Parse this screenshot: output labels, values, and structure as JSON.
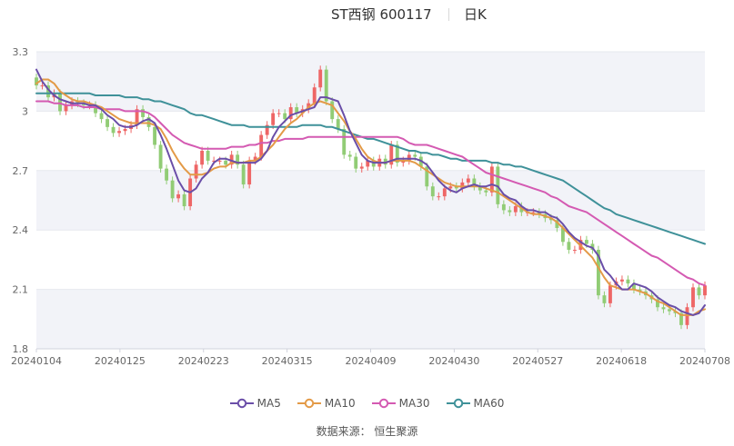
{
  "header": {
    "title": "ST西钢 600117",
    "period": "日K"
  },
  "source": "数据来源： 恒生聚源",
  "colors": {
    "up": "#ee6666",
    "down": "#91cc75",
    "ma5": "#6a4ea8",
    "ma10": "#e39a47",
    "ma30": "#d45ab2",
    "ma60": "#3f9199",
    "band": "#f2f3f8",
    "grid": "#e6e8ee"
  },
  "chart_data": {
    "type": "candlestick",
    "title": "ST西钢 600117 日K",
    "ylim": [
      1.8,
      3.3
    ],
    "yticks": [
      "1.8",
      "2.1",
      "2.4",
      "2.7",
      "3",
      "3.3"
    ],
    "xticks": [
      "20240104",
      "20240125",
      "20240223",
      "20240315",
      "20240409",
      "20240430",
      "20240527",
      "20240618",
      "20240708"
    ],
    "legend": [
      "MA5",
      "MA10",
      "MA30",
      "MA60"
    ],
    "close": [
      3.13,
      3.13,
      3.07,
      3.09,
      3.0,
      3.03,
      3.05,
      3.04,
      3.03,
      3.03,
      2.99,
      2.96,
      2.92,
      2.89,
      2.9,
      2.91,
      2.93,
      3.01,
      2.97,
      2.92,
      2.83,
      2.71,
      2.65,
      2.56,
      2.58,
      2.52,
      2.66,
      2.73,
      2.8,
      2.75,
      2.75,
      2.75,
      2.73,
      2.78,
      2.73,
      2.63,
      2.75,
      2.77,
      2.88,
      2.93,
      2.99,
      2.99,
      2.96,
      3.02,
      2.99,
      3.01,
      3.04,
      3.12,
      3.21,
      3.05,
      2.96,
      2.91,
      2.78,
      2.77,
      2.71,
      2.72,
      2.75,
      2.72,
      2.76,
      2.73,
      2.83,
      2.74,
      2.75,
      2.78,
      2.77,
      2.72,
      2.62,
      2.57,
      2.57,
      2.61,
      2.62,
      2.61,
      2.64,
      2.66,
      2.62,
      2.6,
      2.59,
      2.72,
      2.53,
      2.5,
      2.49,
      2.52,
      2.49,
      2.49,
      2.49,
      2.48,
      2.46,
      2.45,
      2.41,
      2.34,
      2.3,
      2.3,
      2.35,
      2.33,
      2.3,
      2.07,
      2.03,
      2.12,
      2.14,
      2.15,
      2.13,
      2.1,
      2.09,
      2.07,
      2.05,
      2.01,
      2.0,
      1.99,
      1.98,
      1.92,
      2.01,
      2.11,
      2.07,
      2.12
    ],
    "ma5": [
      3.21,
      3.15,
      3.11,
      3.08,
      3.06,
      3.05,
      3.04,
      3.04,
      3.04,
      3.03,
      3.03,
      3.01,
      2.98,
      2.96,
      2.93,
      2.92,
      2.92,
      2.93,
      2.95,
      2.96,
      2.94,
      2.88,
      2.81,
      2.73,
      2.65,
      2.6,
      2.59,
      2.61,
      2.66,
      2.69,
      2.74,
      2.76,
      2.76,
      2.75,
      2.74,
      2.74,
      2.74,
      2.74,
      2.76,
      2.8,
      2.87,
      2.92,
      2.95,
      2.98,
      2.99,
      3.0,
      3.01,
      3.02,
      3.07,
      3.07,
      3.06,
      3.05,
      2.98,
      2.9,
      2.84,
      2.78,
      2.75,
      2.74,
      2.74,
      2.74,
      2.75,
      2.76,
      2.76,
      2.76,
      2.76,
      2.75,
      2.73,
      2.69,
      2.65,
      2.62,
      2.6,
      2.59,
      2.61,
      2.62,
      2.63,
      2.62,
      2.62,
      2.63,
      2.62,
      2.58,
      2.56,
      2.55,
      2.52,
      2.5,
      2.5,
      2.49,
      2.49,
      2.47,
      2.46,
      2.43,
      2.39,
      2.36,
      2.34,
      2.32,
      2.31,
      2.27,
      2.2,
      2.17,
      2.13,
      2.1,
      2.1,
      2.13,
      2.12,
      2.11,
      2.09,
      2.06,
      2.04,
      2.02,
      2.01,
      1.99,
      1.98,
      1.97,
      1.98,
      2.02
    ],
    "ma10": [
      3.14,
      3.16,
      3.16,
      3.14,
      3.1,
      3.08,
      3.06,
      3.05,
      3.05,
      3.04,
      3.03,
      3.02,
      3.0,
      2.98,
      2.96,
      2.95,
      2.94,
      2.94,
      2.94,
      2.94,
      2.93,
      2.91,
      2.86,
      2.8,
      2.75,
      2.71,
      2.68,
      2.68,
      2.68,
      2.69,
      2.71,
      2.72,
      2.72,
      2.74,
      2.74,
      2.74,
      2.75,
      2.75,
      2.77,
      2.8,
      2.83,
      2.87,
      2.91,
      2.94,
      2.96,
      2.99,
      3.02,
      3.04,
      3.05,
      3.04,
      3.03,
      2.99,
      2.95,
      2.9,
      2.86,
      2.81,
      2.77,
      2.75,
      2.74,
      2.74,
      2.75,
      2.75,
      2.75,
      2.75,
      2.74,
      2.72,
      2.7,
      2.68,
      2.66,
      2.64,
      2.63,
      2.62,
      2.62,
      2.62,
      2.62,
      2.62,
      2.61,
      2.6,
      2.59,
      2.57,
      2.55,
      2.53,
      2.51,
      2.49,
      2.48,
      2.48,
      2.47,
      2.46,
      2.44,
      2.41,
      2.38,
      2.35,
      2.32,
      2.29,
      2.26,
      2.21,
      2.16,
      2.12,
      2.11,
      2.1,
      2.1,
      2.1,
      2.09,
      2.08,
      2.06,
      2.04,
      2.03,
      2.01,
      1.99,
      1.97,
      1.97,
      1.97,
      1.99,
      2.0
    ],
    "ma30": [
      3.05,
      3.05,
      3.05,
      3.04,
      3.04,
      3.03,
      3.03,
      3.03,
      3.02,
      3.02,
      3.02,
      3.01,
      3.01,
      3.01,
      3.01,
      3.0,
      3.0,
      3.0,
      3.0,
      2.99,
      2.97,
      2.94,
      2.91,
      2.88,
      2.86,
      2.84,
      2.83,
      2.82,
      2.81,
      2.81,
      2.81,
      2.81,
      2.81,
      2.82,
      2.82,
      2.82,
      2.83,
      2.83,
      2.84,
      2.84,
      2.85,
      2.85,
      2.86,
      2.86,
      2.86,
      2.86,
      2.87,
      2.87,
      2.87,
      2.87,
      2.87,
      2.87,
      2.87,
      2.87,
      2.87,
      2.87,
      2.87,
      2.87,
      2.87,
      2.87,
      2.87,
      2.87,
      2.86,
      2.84,
      2.83,
      2.83,
      2.83,
      2.82,
      2.81,
      2.8,
      2.79,
      2.78,
      2.77,
      2.75,
      2.73,
      2.71,
      2.69,
      2.68,
      2.67,
      2.66,
      2.65,
      2.64,
      2.63,
      2.62,
      2.61,
      2.6,
      2.59,
      2.57,
      2.56,
      2.54,
      2.52,
      2.51,
      2.5,
      2.49,
      2.47,
      2.45,
      2.43,
      2.41,
      2.39,
      2.37,
      2.35,
      2.33,
      2.31,
      2.29,
      2.27,
      2.26,
      2.24,
      2.22,
      2.2,
      2.18,
      2.16,
      2.15,
      2.13,
      2.12
    ],
    "ma60": [
      3.09,
      3.09,
      3.09,
      3.09,
      3.09,
      3.09,
      3.09,
      3.09,
      3.09,
      3.09,
      3.08,
      3.08,
      3.08,
      3.08,
      3.08,
      3.07,
      3.07,
      3.07,
      3.06,
      3.06,
      3.05,
      3.05,
      3.04,
      3.03,
      3.02,
      3.01,
      2.99,
      2.98,
      2.98,
      2.97,
      2.96,
      2.95,
      2.94,
      2.93,
      2.93,
      2.93,
      2.92,
      2.92,
      2.92,
      2.92,
      2.92,
      2.92,
      2.92,
      2.92,
      2.92,
      2.93,
      2.93,
      2.93,
      2.93,
      2.92,
      2.92,
      2.91,
      2.9,
      2.89,
      2.88,
      2.87,
      2.86,
      2.86,
      2.85,
      2.84,
      2.83,
      2.82,
      2.81,
      2.8,
      2.8,
      2.79,
      2.79,
      2.78,
      2.78,
      2.77,
      2.76,
      2.76,
      2.75,
      2.75,
      2.75,
      2.75,
      2.75,
      2.74,
      2.74,
      2.73,
      2.73,
      2.72,
      2.72,
      2.71,
      2.7,
      2.69,
      2.68,
      2.67,
      2.66,
      2.65,
      2.63,
      2.61,
      2.59,
      2.57,
      2.55,
      2.53,
      2.51,
      2.5,
      2.48,
      2.47,
      2.46,
      2.45,
      2.44,
      2.43,
      2.42,
      2.41,
      2.4,
      2.39,
      2.38,
      2.37,
      2.36,
      2.35,
      2.34,
      2.33
    ]
  }
}
